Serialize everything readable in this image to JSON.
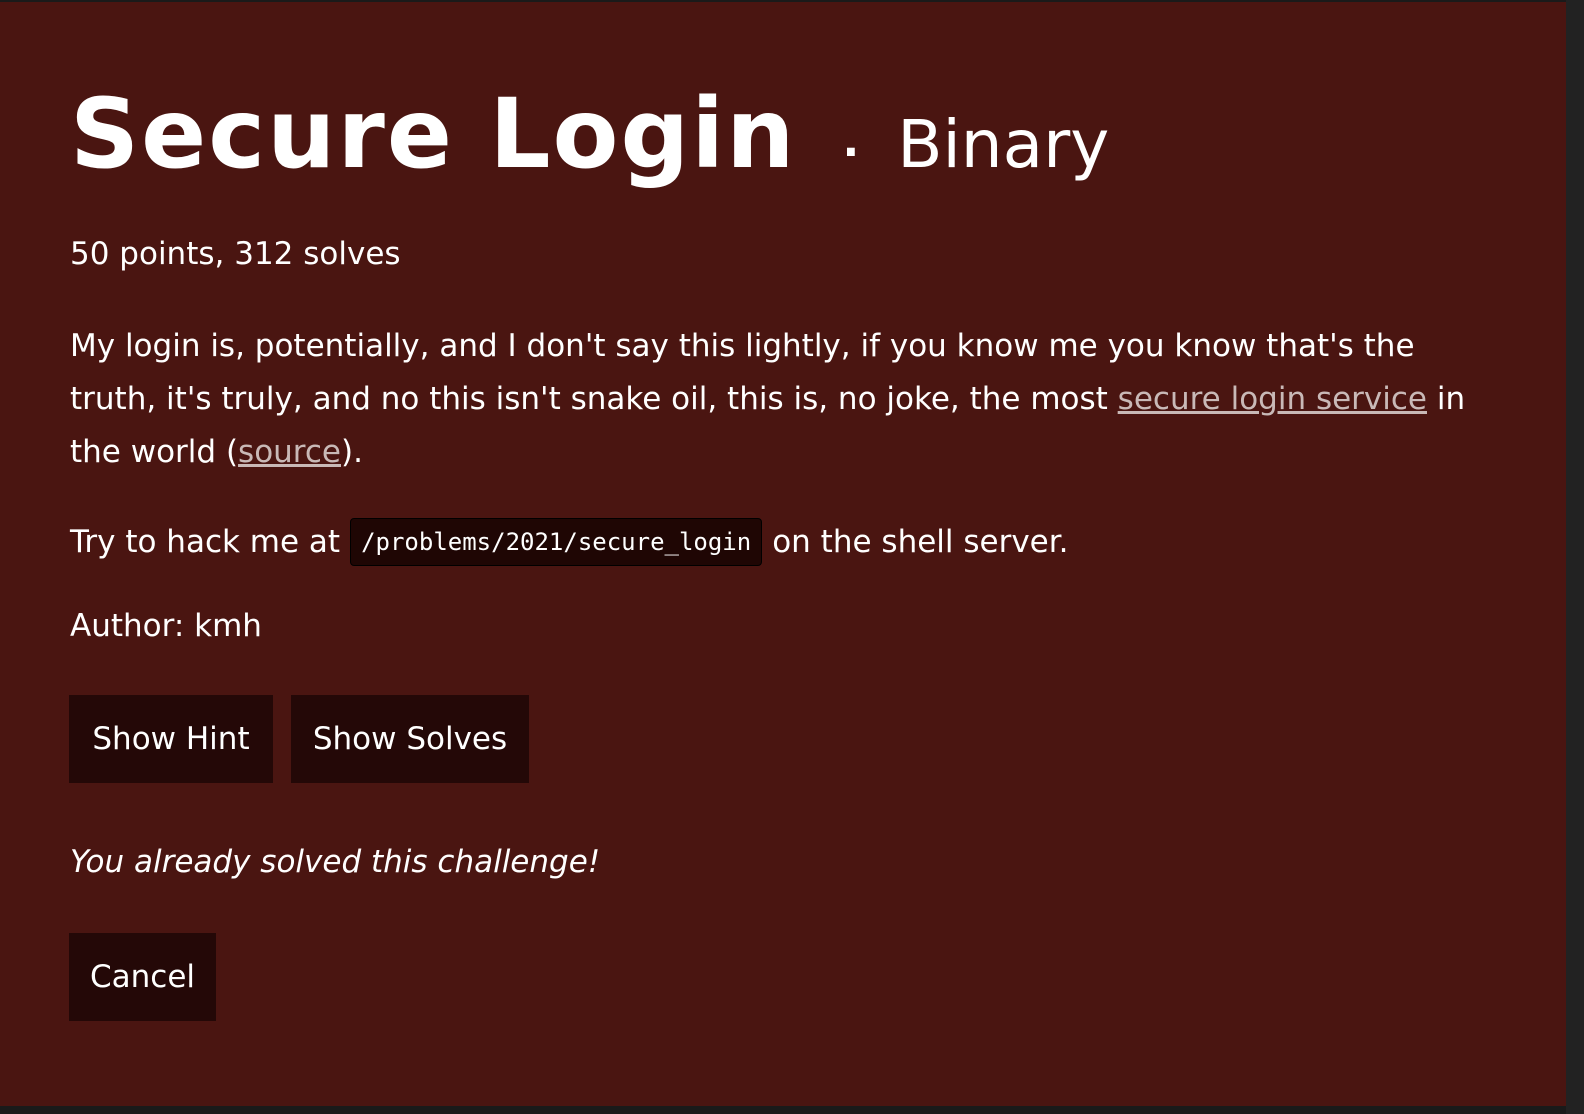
{
  "challenge": {
    "title": "Secure Login",
    "separator": "·",
    "category": "Binary",
    "meta": "50 points, 312 solves",
    "description": {
      "part1": "My login is, potentially, and I don't say this lightly, if you know me you know that's the truth, it's truly, and no this isn't snake oil, this is, no joke, the most ",
      "link1": "secure login service",
      "part2": " in the world (",
      "link2": "source",
      "part3": ")."
    },
    "shell": {
      "prefix": "Try to hack me at",
      "path": "/problems/2021/secure_login",
      "suffix": "on the shell server."
    },
    "author": "Author: kmh",
    "solved_message": "You already solved this challenge!"
  },
  "buttons": {
    "show_hint": "Show Hint",
    "show_solves": "Show Solves",
    "cancel": "Cancel"
  },
  "colors": {
    "background": "#4a1511",
    "button": "#240807",
    "link": "#c9b9b7"
  }
}
